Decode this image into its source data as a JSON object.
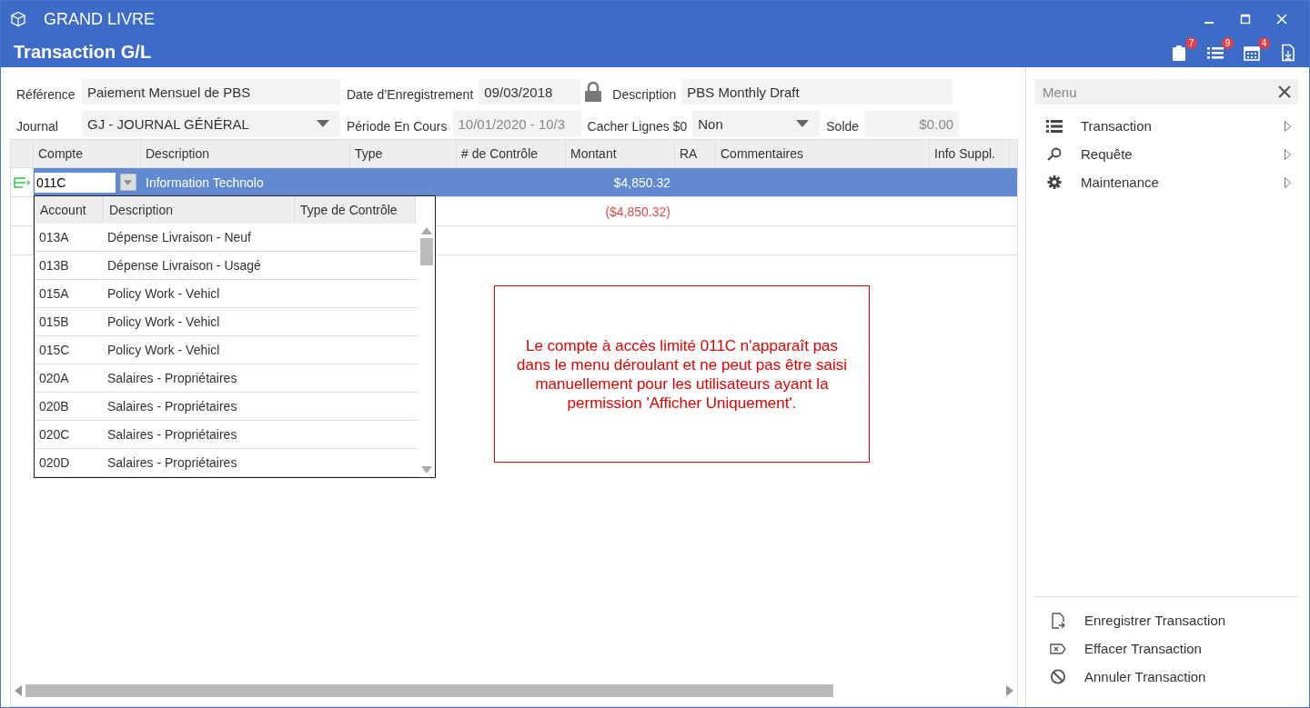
{
  "window": {
    "title": "GRAND LIVRE"
  },
  "header": {
    "title": "Transaction G/L",
    "tools": [
      {
        "kind": "clipboard",
        "badge": "7"
      },
      {
        "kind": "list",
        "badge": "9"
      },
      {
        "kind": "calendar",
        "badge": "4"
      },
      {
        "kind": "document"
      }
    ]
  },
  "form": {
    "row1": [
      {
        "label": "Référence",
        "value": "Paiement Mensuel de PBS",
        "kind": "text"
      },
      {
        "label": "Date d’Enregistrement",
        "value": "09/03/2018",
        "kind": "locked"
      },
      {
        "label": "Description",
        "value": "PBS Monthly Draft",
        "kind": "text"
      }
    ],
    "row2": [
      {
        "label": "Journal",
        "value": "GJ - JOURNAL GÉNÉRAL",
        "kind": "select"
      },
      {
        "label": "Période En Cours",
        "value": "10/01/2020 - 10/3",
        "kind": "readonly"
      },
      {
        "label": "Cacher Lignes $0",
        "value": "Non",
        "kind": "select"
      },
      {
        "label": "Solde",
        "value": "$0.00",
        "kind": "amount"
      }
    ]
  },
  "grid": {
    "columns": [
      "Compte",
      "Description",
      "Type",
      "# de Contrôle",
      "Montant",
      "RA",
      "Commentaires",
      "Info Suppl."
    ],
    "rows": [
      {
        "selected": true,
        "compte": "011C",
        "description": "Information Technolo",
        "montant": "$4,850.32",
        "negative": false
      },
      {
        "selected": false,
        "montant": "($4,850.32)",
        "negative": true
      },
      {
        "selected": false
      }
    ]
  },
  "dropdown": {
    "columns": [
      "Account",
      "Description",
      "Type de Contrôle"
    ],
    "rows": [
      {
        "account": "013A",
        "description": "Dépense Livraison - Neuf"
      },
      {
        "account": "013B",
        "description": "Dépense Livraison - Usagé"
      },
      {
        "account": "015A",
        "description": "Policy Work - Vehicl"
      },
      {
        "account": "015B",
        "description": "Policy Work - Vehicl"
      },
      {
        "account": "015C",
        "description": "Policy Work - Vehicl"
      },
      {
        "account": "020A",
        "description": "Salaires - Propriétaires"
      },
      {
        "account": "020B",
        "description": "Salaires - Propriétaires"
      },
      {
        "account": "020C",
        "description": "Salaires - Propriétaires"
      },
      {
        "account": "020D",
        "description": "Salaires - Propriétaires"
      }
    ]
  },
  "note": "Le compte à accès limité 011C n'apparaît pas dans le menu déroulant et ne peut pas être saisi manuellement pour les utilisateurs ayant la permission 'Afficher Uniquement'.",
  "side_menu": {
    "title": "Menu",
    "items": [
      {
        "label": "Transaction",
        "kind": "list"
      },
      {
        "label": "Requête",
        "kind": "search"
      },
      {
        "label": "Maintenance",
        "kind": "gear"
      }
    ],
    "actions": [
      {
        "label": "Enregistrer Transaction",
        "kind": "save"
      },
      {
        "label": "Effacer Transaction",
        "kind": "clear"
      },
      {
        "label": "Annuler Transaction",
        "kind": "cancel"
      }
    ]
  }
}
